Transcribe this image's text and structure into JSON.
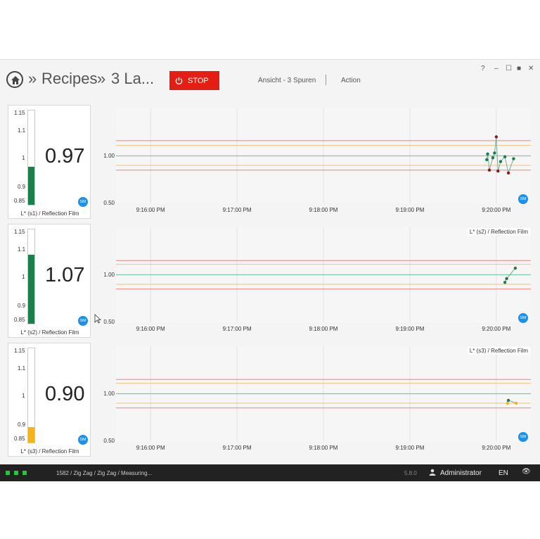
{
  "header": {
    "breadcrumb_sep1": "»",
    "breadcrumb_recipes": "Recipes",
    "breadcrumb_sep2": "»",
    "breadcrumb_current": "3 La...",
    "stop_label": "STOP",
    "view_label": "Ansicht - 3 Spuren",
    "action_label": "Action",
    "help": "?",
    "minimize": "–",
    "maximize": "☐",
    "restore": "■",
    "close": "✕"
  },
  "gauge_ticks": [
    "1.15",
    "1.1",
    "1",
    "0.9",
    "0.85"
  ],
  "sim_label": "SIM",
  "cards": [
    {
      "value": "0.97",
      "label": "L* (s1) / Reflection Film",
      "level": 0.97,
      "color": "#1a7f4b"
    },
    {
      "value": "1.07",
      "label": "L* (s2) / Reflection Film",
      "level": 1.07,
      "color": "#1a7f4b"
    },
    {
      "value": "0.90",
      "label": "L* (s3) / Reflection Film",
      "level": 0.9,
      "color": "#f2b419"
    }
  ],
  "chart_data": [
    {
      "type": "line",
      "series_label": "",
      "x_ticks": [
        "9:16:00 PM",
        "9:17:00 PM",
        "9:18:00 PM",
        "9:19:00 PM",
        "9:20:00 PM"
      ],
      "y_ticks": [
        "1.00",
        "0.50"
      ],
      "limits": {
        "upper_red": 1.16,
        "upper_orange": 1.11,
        "target": 1.0,
        "lower_orange": 0.9,
        "lower_red": 0.85
      },
      "ylim": [
        0.5,
        1.5
      ],
      "points": [
        {
          "t": 9.09,
          "v": 0.96
        },
        {
          "t": 9.1,
          "v": 1.02
        },
        {
          "t": 9.12,
          "v": 0.85
        },
        {
          "t": 9.16,
          "v": 0.98
        },
        {
          "t": 9.18,
          "v": 1.03
        },
        {
          "t": 9.2,
          "v": 1.2
        },
        {
          "t": 9.22,
          "v": 0.84
        },
        {
          "t": 9.25,
          "v": 0.94
        },
        {
          "t": 9.3,
          "v": 0.99
        },
        {
          "t": 9.34,
          "v": 0.82
        },
        {
          "t": 9.4,
          "v": 0.97
        }
      ],
      "point_colors": [
        "#1a7f4b",
        "#1a7f4b",
        "#8b1a1a",
        "#1a7f4b",
        "#1a7f4b",
        "#8b1a1a",
        "#8b1a1a",
        "#1a7f4b",
        "#1a7f4b",
        "#8b1a1a",
        "#1a7f4b"
      ]
    },
    {
      "type": "line",
      "series_label": "L* (s2) / Reflection Film",
      "x_ticks": [
        "9:16:00 PM",
        "9:17:00 PM",
        "9:18:00 PM",
        "9:19:00 PM",
        "9:20:00 PM"
      ],
      "y_ticks": [
        "1.00",
        "0.50"
      ],
      "limits": {
        "upper_red": 1.15,
        "upper_orange": 1.11,
        "target": 1.0,
        "lower_orange": 0.9,
        "lower_red": 0.85
      },
      "ylim": [
        0.5,
        1.5
      ],
      "points": [
        {
          "t": 9.3,
          "v": 0.92
        },
        {
          "t": 9.32,
          "v": 0.96
        },
        {
          "t": 9.42,
          "v": 1.07
        }
      ],
      "point_colors": [
        "#1a7f4b",
        "#1a7f4b",
        "#1a7f4b"
      ]
    },
    {
      "type": "line",
      "series_label": "L* (s3) / Reflection Film",
      "x_ticks": [
        "9:16:00 PM",
        "9:17:00 PM",
        "9:18:00 PM",
        "9:19:00 PM",
        "9:20:00 PM"
      ],
      "y_ticks": [
        "1.00",
        "0.50"
      ],
      "limits": {
        "upper_red": 1.15,
        "upper_orange": 1.11,
        "target": 1.0,
        "lower_orange": 0.9,
        "lower_red": 0.85
      },
      "ylim": [
        0.5,
        1.5
      ],
      "points": [
        {
          "t": 9.33,
          "v": 0.9
        },
        {
          "t": 9.34,
          "v": 0.93
        },
        {
          "t": 9.43,
          "v": 0.9
        }
      ],
      "point_colors": [
        "#f2b419",
        "#1a7f4b",
        "#f2b419"
      ]
    }
  ],
  "statusbar": {
    "path": "1582 / Zig Zag / Zig Zag / Measuring...",
    "version": "5.8.0",
    "user": "Administrator",
    "language": "EN",
    "eye": "👁"
  },
  "colors": {
    "accent_stop": "#e41e12",
    "green": "#1a7f4b",
    "red_limit": "#f08080",
    "orange_limit": "#f0c27a",
    "target": "#7fc8a9"
  }
}
